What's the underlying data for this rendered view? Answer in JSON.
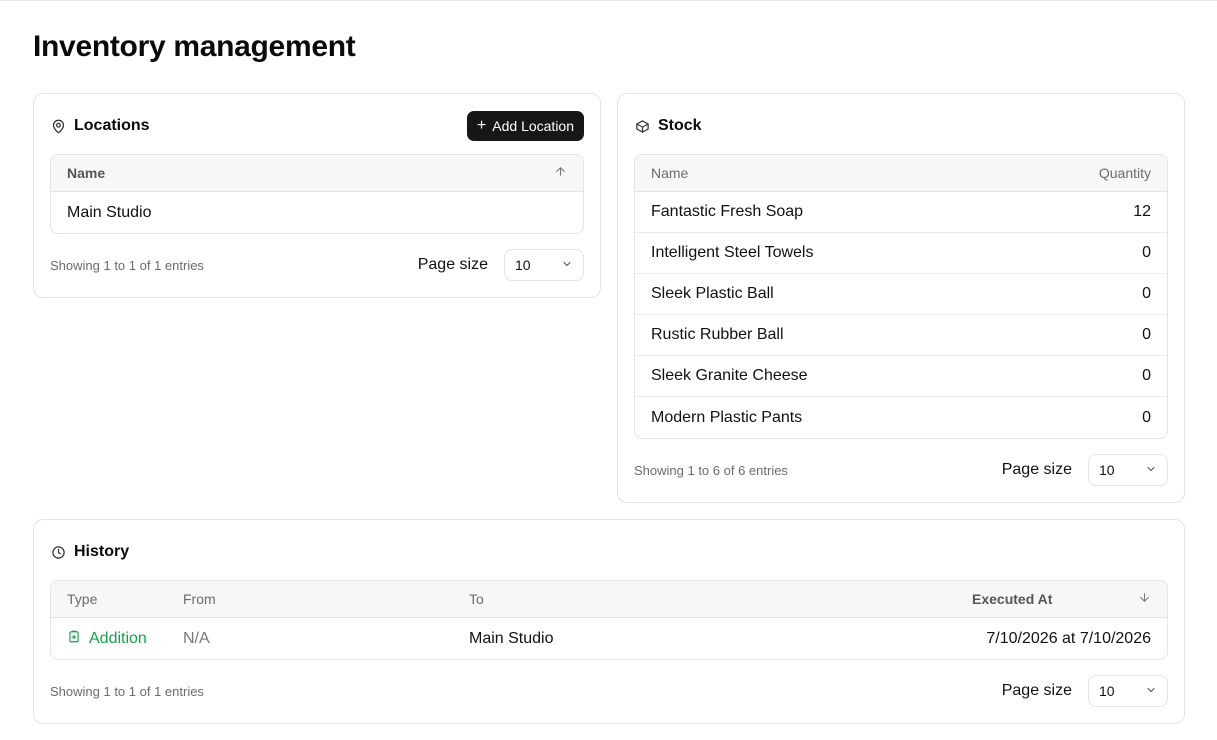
{
  "page": {
    "title": "Inventory management"
  },
  "locations": {
    "title": "Locations",
    "add_button": "Add Location",
    "columns": [
      "Name"
    ],
    "rows": [
      {
        "name": "Main Studio"
      }
    ],
    "showing": "Showing 1 to 1 of 1 entries",
    "page_size_label": "Page size",
    "page_size": "10"
  },
  "stock": {
    "title": "Stock",
    "columns": [
      "Name",
      "Quantity"
    ],
    "rows": [
      {
        "name": "Fantastic Fresh Soap",
        "quantity": "12"
      },
      {
        "name": "Intelligent Steel Towels",
        "quantity": "0"
      },
      {
        "name": "Sleek Plastic Ball",
        "quantity": "0"
      },
      {
        "name": "Rustic Rubber Ball",
        "quantity": "0"
      },
      {
        "name": "Sleek Granite Cheese",
        "quantity": "0"
      },
      {
        "name": "Modern Plastic Pants",
        "quantity": "0"
      }
    ],
    "showing": "Showing 1 to 6 of 6 entries",
    "page_size_label": "Page size",
    "page_size": "10"
  },
  "history": {
    "title": "History",
    "columns": [
      "Type",
      "From",
      "To",
      "Executed At"
    ],
    "rows": [
      {
        "type": "Addition",
        "from": "N/A",
        "to": "Main Studio",
        "executed_at": "7/10/2026 at 7/10/2026"
      }
    ],
    "showing": "Showing 1 to 1 of 1 entries",
    "page_size_label": "Page size",
    "page_size": "10"
  },
  "colors": {
    "accent_dark": "#171717",
    "addition_green": "#16a34a",
    "border": "#e4e4e7"
  },
  "icons": {
    "locations": "map-pin-icon",
    "stock": "package-icon",
    "history": "clock-icon",
    "sort_asc": "arrow-up-icon",
    "sort_desc": "arrow-down-icon",
    "dropdown": "chevron-down-icon",
    "addition": "clipboard-plus-icon"
  }
}
